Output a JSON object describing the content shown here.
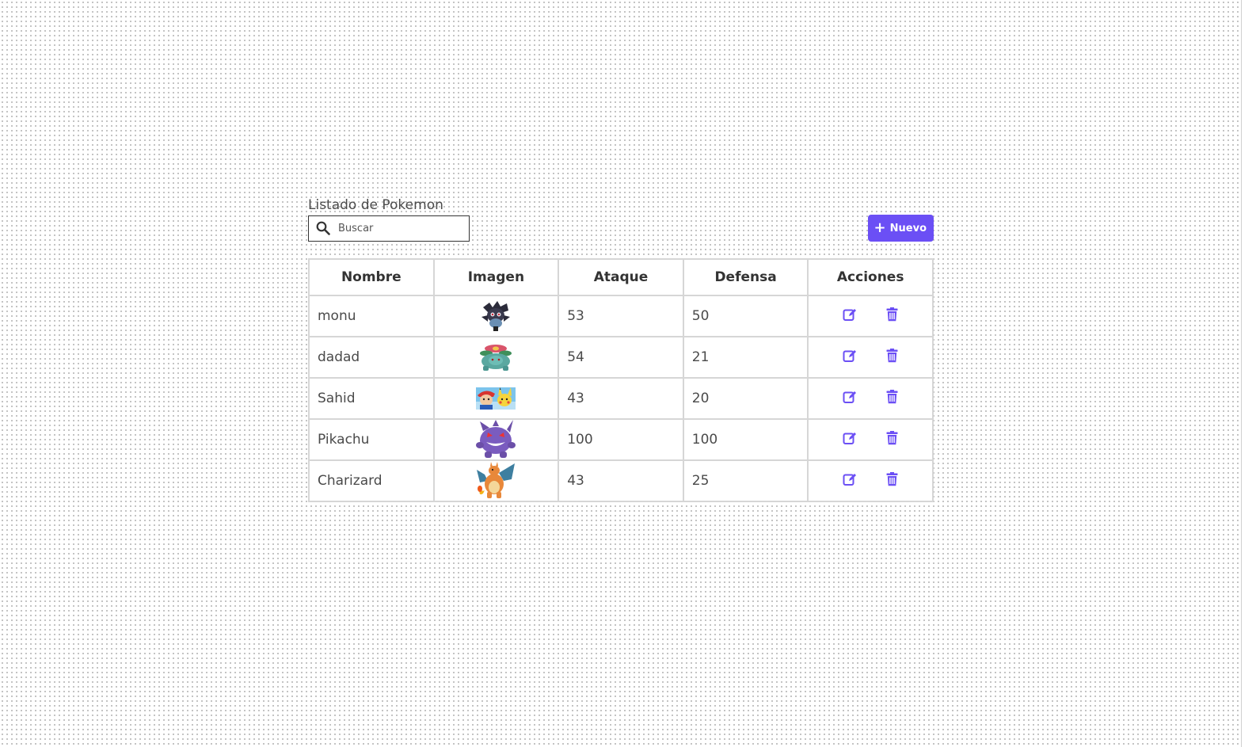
{
  "page": {
    "title": "Listado de Pokemon"
  },
  "search": {
    "placeholder": "Buscar",
    "icon": "search-icon"
  },
  "toolbar": {
    "new_label": "Nuevo",
    "new_icon": "plus-icon"
  },
  "table": {
    "columns": [
      "Nombre",
      "Imagen",
      "Ataque",
      "Defensa",
      "Acciones"
    ],
    "rows": [
      {
        "name": "monu",
        "image": "dark-spiky-pokemon-image",
        "attack": "53",
        "defense": "50"
      },
      {
        "name": "dadad",
        "image": "venusaur-image",
        "attack": "54",
        "defense": "21"
      },
      {
        "name": "Sahid",
        "image": "ash-and-pikachu-image",
        "attack": "43",
        "defense": "20"
      },
      {
        "name": "Pikachu",
        "image": "gengar-image",
        "attack": "100",
        "defense": "100"
      },
      {
        "name": "Charizard",
        "image": "charizard-image",
        "attack": "43",
        "defense": "25"
      }
    ]
  },
  "colors": {
    "accent": "#6b4ff5",
    "border": "#d6d6d6",
    "text": "#4a4a4a"
  }
}
